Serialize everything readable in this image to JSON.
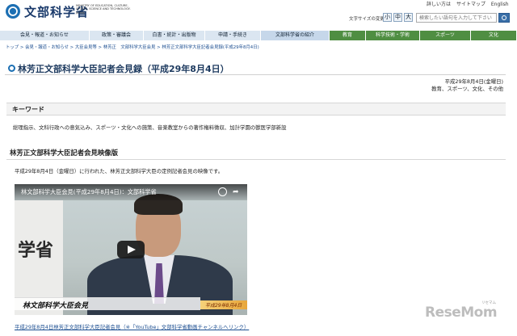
{
  "header": {
    "logo_title": "文部科学省",
    "logo_sub": "MINISTRY OF EDUCATION, CULTURE, SPORTS, SCIENCE AND TECHNOLOGY-JAPAN",
    "util_links": [
      "詳しい方は",
      "サイトマップ",
      "English"
    ],
    "textsize_label": "文字サイズの変更",
    "textsize_buttons": [
      "小",
      "中",
      "大"
    ],
    "search_placeholder": "検索したい語句を入力して下さい"
  },
  "nav": {
    "items": [
      "会見・報道・お知らせ",
      "政策・審議会",
      "白書・統計・出版物",
      "申請・手続き",
      "文部科学省の紹介",
      "教育",
      "科学技術・学術",
      "スポーツ",
      "文化"
    ]
  },
  "breadcrumb": "トップ > 会見・報道・お知らせ > 大臣会見等 > 林芳正　文部科学大臣会見 > 林芳正文部科学大臣記者会見録(平成29年8月4日)",
  "page": {
    "title": "林芳正文部科学大臣記者会見録（平成29年8月4日）",
    "date": "平成29年8月4日(金曜日)",
    "categories": "教育、スポーツ、文化、その他"
  },
  "keywords_section": {
    "heading": "キーワード",
    "text": "総理指示、文科行政への意気込み、スポーツ・文化への施策、音楽教室からの著作権料徴収、加計学園の獣医学部新設"
  },
  "video_section": {
    "heading": "林芳正文部科学大臣記者会見映像版",
    "intro": "平成29年8月4日（金曜日）に行われた、林芳正文部科学大臣の定例記者会見の映像です。",
    "player_title": "林文部科学大臣会見(平成29年8月4日)：文部科学省",
    "backdrop_text": "学省",
    "caption": "林文部科学大臣会見",
    "caption_date": "平成29年8月4日",
    "link_text": "平成29年8月4日林芳正文部科学大臣記者会見（※「YouTube」文部科学省動画チャンネルへリンク）"
  },
  "watermark": {
    "brand": "ReseMom",
    "sub": "リセマム"
  },
  "colors": {
    "nav_light": "#dbe6f1",
    "nav_mid": "#c6d7ea",
    "nav_green": "#4f8e42",
    "link_blue": "#1d4f91"
  }
}
